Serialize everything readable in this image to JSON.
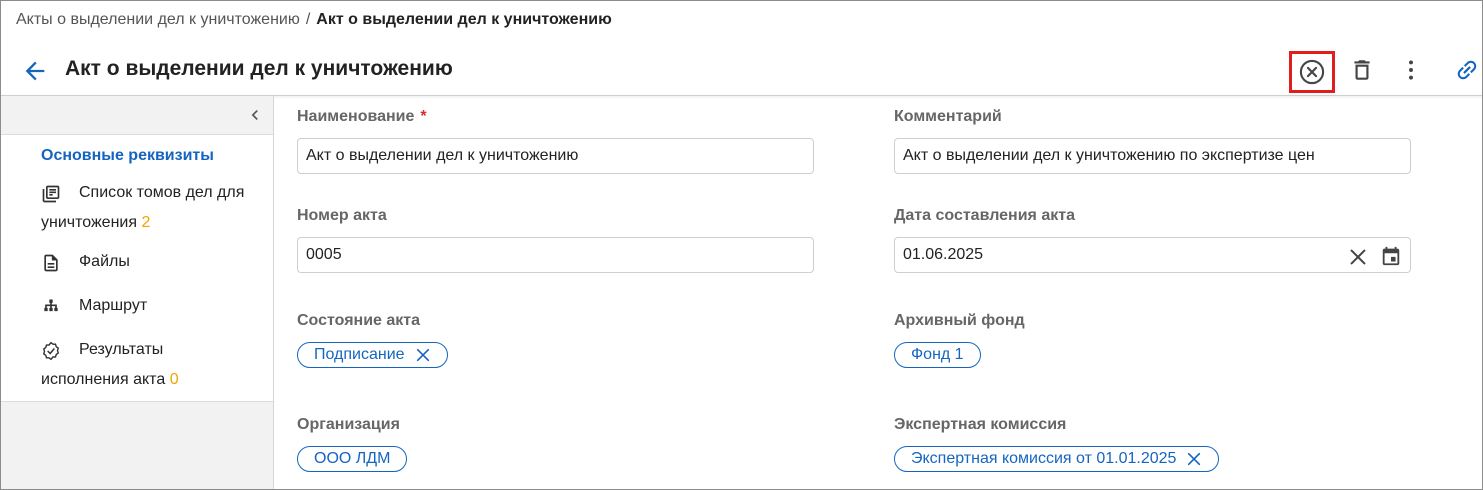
{
  "breadcrumb": {
    "parent": "Акты о выделении дел к уничтожению",
    "separator": "/",
    "current": "Акт о выделении дел к уничтожению"
  },
  "header": {
    "title": "Акт о выделении дел к уничтожению"
  },
  "sidebar": {
    "active": "Основные реквизиты",
    "items": [
      {
        "line1": "Список томов дел для",
        "line2": "уничтожения",
        "count": "2",
        "icon": "volume-list-icon"
      },
      {
        "line1": "Файлы",
        "icon": "files-icon"
      },
      {
        "line1": "Маршрут",
        "icon": "route-icon"
      },
      {
        "line1": "Результаты",
        "line2": "исполнения акта",
        "count": "0",
        "icon": "verified-badge-icon"
      }
    ]
  },
  "form": {
    "name": {
      "label": "Наименование",
      "required": "*",
      "value": "Акт о выделении дел к уничтожению"
    },
    "comment": {
      "label": "Комментарий",
      "value": "Акт о выделении дел к уничтожению по экспертизе цен"
    },
    "act_number": {
      "label": "Номер акта",
      "value": "0005"
    },
    "date": {
      "label": "Дата составления акта",
      "value": "01.06.2025"
    },
    "state": {
      "label": "Состояние акта",
      "chip": "Подписание"
    },
    "fund": {
      "label": "Архивный фонд",
      "chip": "Фонд 1"
    },
    "organization": {
      "label": "Организация",
      "chip": "ООО ЛДМ"
    },
    "commission": {
      "label": "Экспертная комиссия",
      "chip": "Экспертная комиссия от 01.01.2025"
    }
  },
  "colors": {
    "accent": "#1565c0",
    "highlight_border": "#e21d1d",
    "count": "#f0a500",
    "required": "#d32f2f"
  }
}
